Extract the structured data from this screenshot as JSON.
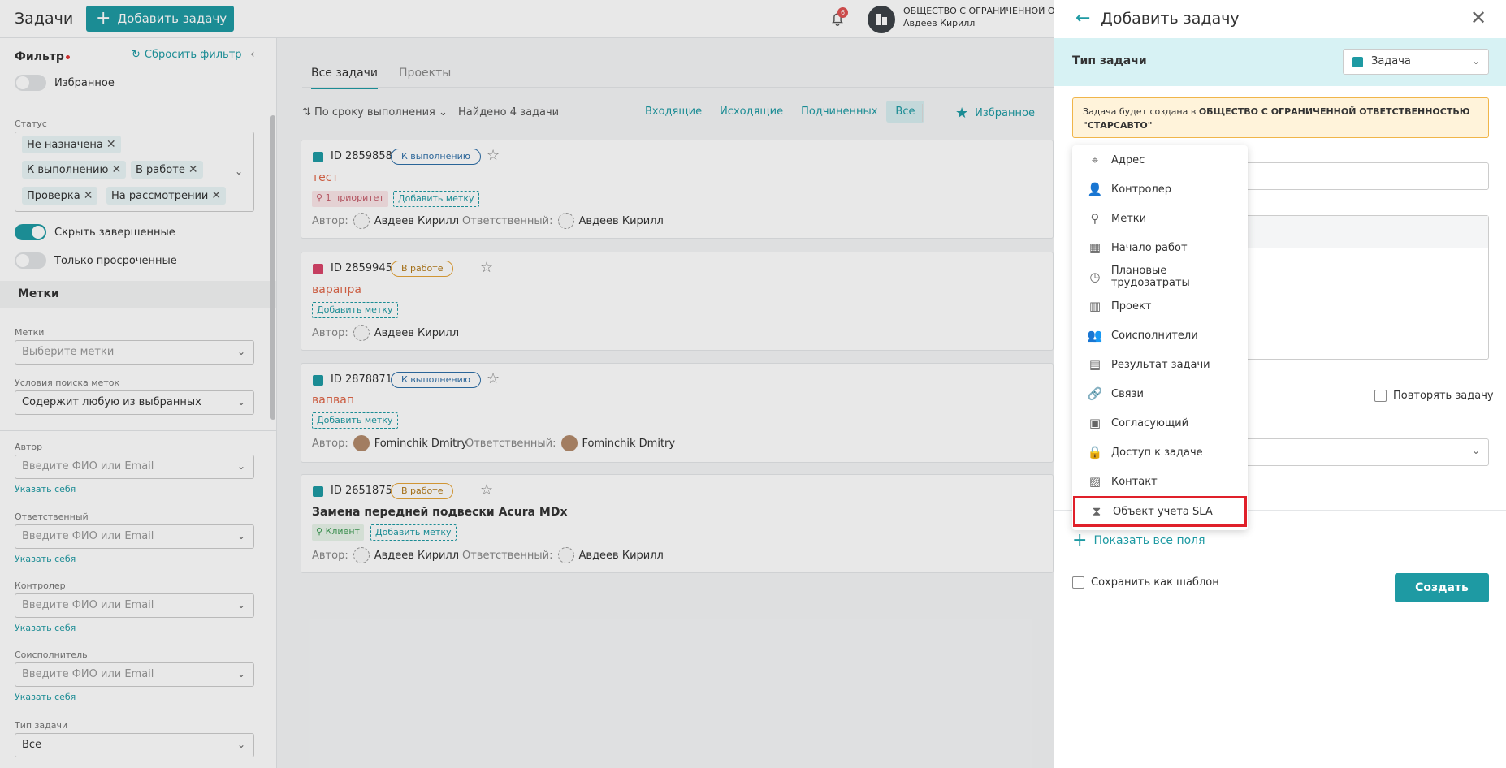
{
  "header": {
    "title": "Задачи",
    "add_task": "Добавить задачу",
    "notifications_count": "6",
    "org_name": "ОБЩЕСТВО С ОГРАНИЧЕННОЙ ОТВ",
    "user_name": "Авдеев Кирилл"
  },
  "filter": {
    "title": "Фильтр",
    "reset": "Сбросить фильтр",
    "favorites_label": "Избранное",
    "status_label": "Статус",
    "status_chips": [
      "Не назначена",
      "К выполнению",
      "В работе",
      "Проверка",
      "На рассмотрении"
    ],
    "hide_done_label": "Скрыть завершенные",
    "overdue_label": "Только просроченные",
    "tags_section": "Метки",
    "tags_label": "Метки",
    "tags_placeholder": "Выберите метки",
    "tag_condition_label": "Условия поиска меток",
    "tag_condition_value": "Содержит любую из выбранных",
    "author_label": "Автор",
    "responsible_label": "Ответственный",
    "controller_label": "Контролер",
    "coexecutor_label": "Соисполнитель",
    "person_placeholder": "Введите ФИО или Email",
    "self_link": "Указать себя",
    "task_type_label": "Тип задачи",
    "task_type_value": "Все"
  },
  "main": {
    "tabs": [
      "Все задачи",
      "Проекты"
    ],
    "sort": "По сроку выполнения",
    "found": "Найдено 4 задачи",
    "segments": [
      "Входящие",
      "Исходящие",
      "Подчиненных",
      "Все"
    ],
    "favorites": "Избранное",
    "author_lbl": "Автор:",
    "responsible_lbl": "Ответственный:",
    "add_tag": "Добавить метку",
    "tasks": [
      {
        "id": "ID 2859858",
        "status": "К выполнению",
        "name": "тест",
        "tag": "1 приоритет",
        "author": "Авдеев Кирилл",
        "responsible": "Авдеев Кирилл"
      },
      {
        "id": "ID 2859945",
        "status": "В работе",
        "name": "варапра",
        "author": "Авдеев Кирилл"
      },
      {
        "id": "ID 2878871",
        "status": "К выполнению",
        "name": "вапвап",
        "author": "Fominchik Dmitry",
        "responsible": "Fominchik Dmitry"
      },
      {
        "id": "ID 2651875",
        "status": "В работе",
        "name": "Замена передней подвески Acura MDx",
        "tag": "Клиент",
        "author": "Авдеев Кирилл",
        "responsible": "Авдеев Кирилл"
      }
    ]
  },
  "panel": {
    "title": "Добавить задачу",
    "type_label": "Тип задачи",
    "type_value": "Задача",
    "notice_prefix": "Задача будет создана в ",
    "notice_org": "ОБЩЕСТВО С ОГРАНИЧЕННОЙ ОТВЕТСТВЕННОСТЬЮ \"СТАРСАВТО\"",
    "repeat": "Повторять задачу",
    "show_all": "Показать все поля",
    "save_template": "Сохранить как шаблон",
    "create": "Создать"
  },
  "menu": {
    "items": [
      {
        "label": "Адрес",
        "icon": "map-pin-icon"
      },
      {
        "label": "Контролер",
        "icon": "user-check-icon"
      },
      {
        "label": "Метки",
        "icon": "tag-icon"
      },
      {
        "label": "Начало работ",
        "icon": "calendar-icon"
      },
      {
        "label": "Плановые трудозатраты",
        "icon": "stopwatch-icon"
      },
      {
        "label": "Проект",
        "icon": "kanban-icon"
      },
      {
        "label": "Соисполнители",
        "icon": "users-icon"
      },
      {
        "label": "Результат задачи",
        "icon": "document-icon"
      },
      {
        "label": "Связи",
        "icon": "link-icon"
      },
      {
        "label": "Согласующий",
        "icon": "approval-icon"
      },
      {
        "label": "Доступ к задаче",
        "icon": "lock-icon"
      },
      {
        "label": "Контакт",
        "icon": "contact-card-icon"
      },
      {
        "label": "Объект учета SLA",
        "icon": "hourglass-icon"
      }
    ]
  },
  "colors": {
    "accent": "#1e9aa3",
    "highlight": "#e0202a",
    "notice_bg": "#fff3da"
  }
}
